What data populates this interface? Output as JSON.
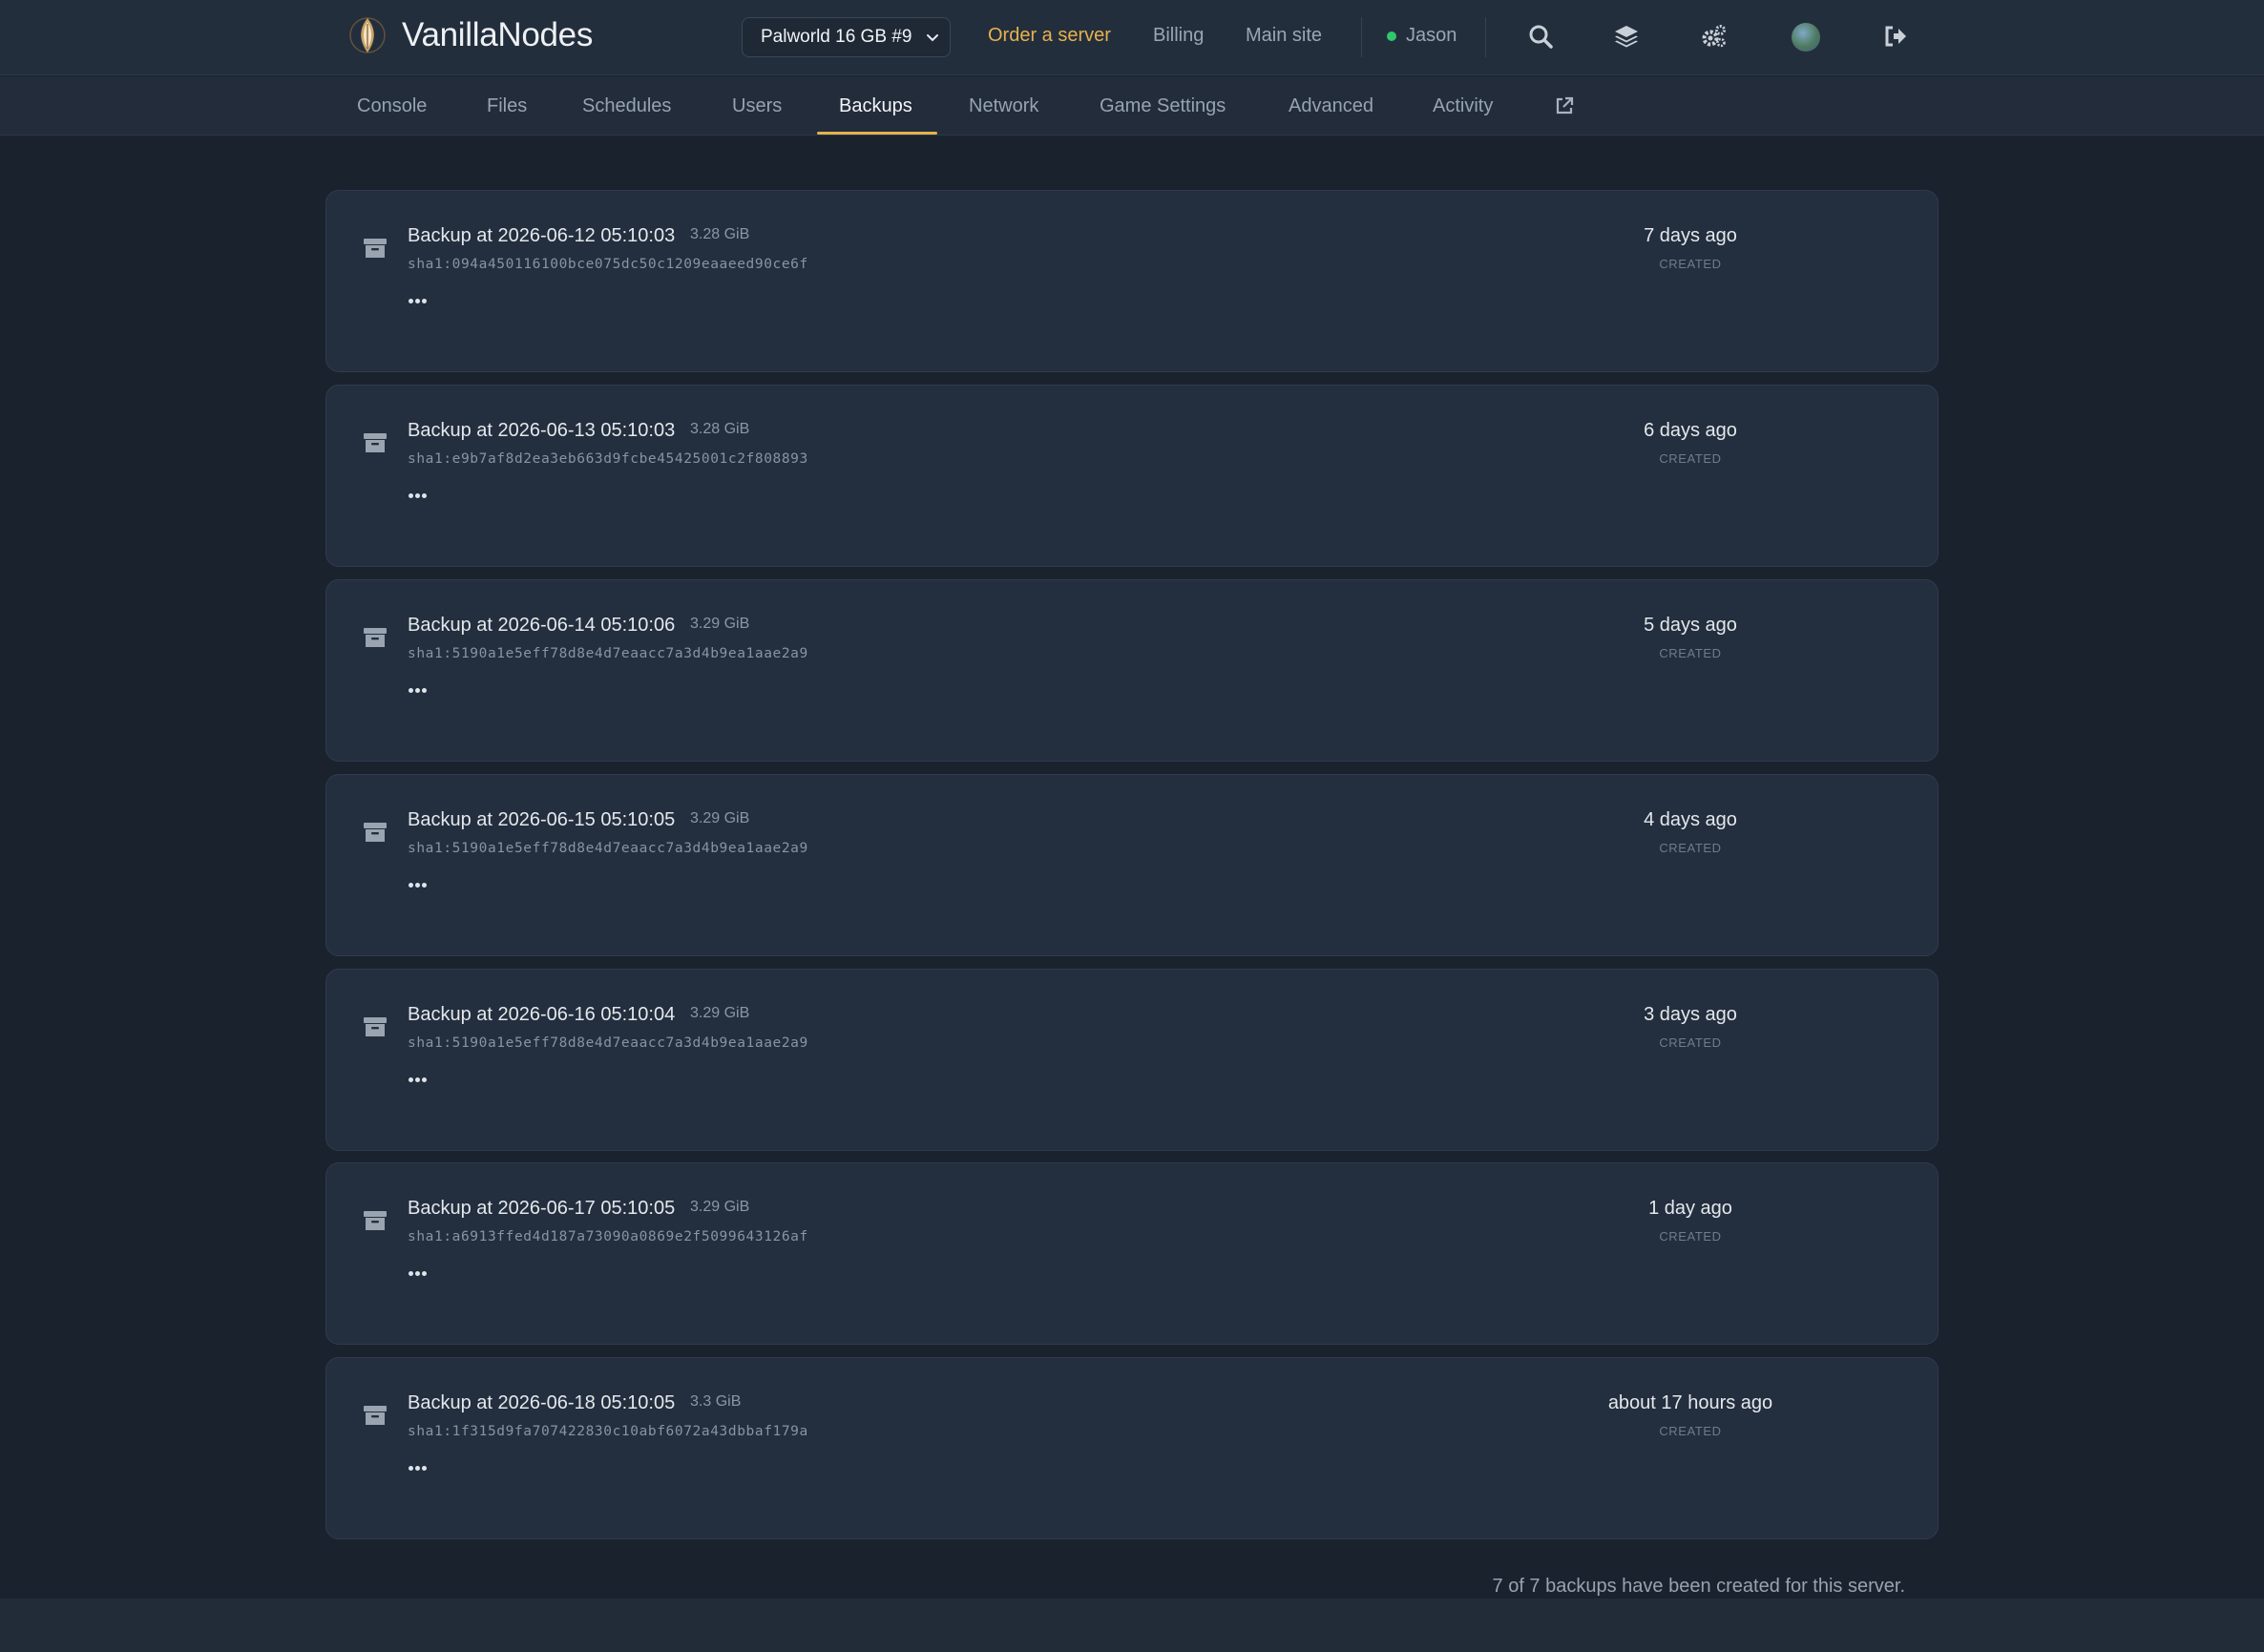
{
  "brand": {
    "name": "VanillaNodes"
  },
  "server_select": {
    "label": "Palworld 16 GB #9"
  },
  "top_nav": {
    "order": "Order a server",
    "billing": "Billing",
    "main_site": "Main site",
    "user": "Jason"
  },
  "tabs": [
    "Console",
    "Files",
    "Schedules",
    "Users",
    "Backups",
    "Network",
    "Game Settings",
    "Advanced",
    "Activity"
  ],
  "active_tab": "Backups",
  "backups": [
    {
      "title": "Backup at 2026-06-12 05:10:03",
      "size": "3.28 GiB",
      "hash": "sha1:094a450116100bce075dc50c1209eaaeed90ce6f",
      "age": "7 days ago",
      "created": "CREATED"
    },
    {
      "title": "Backup at 2026-06-13 05:10:03",
      "size": "3.28 GiB",
      "hash": "sha1:e9b7af8d2ea3eb663d9fcbe45425001c2f808893",
      "age": "6 days ago",
      "created": "CREATED"
    },
    {
      "title": "Backup at 2026-06-14 05:10:06",
      "size": "3.29 GiB",
      "hash": "sha1:5190a1e5eff78d8e4d7eaacc7a3d4b9ea1aae2a9",
      "age": "5 days ago",
      "created": "CREATED"
    },
    {
      "title": "Backup at 2026-06-15 05:10:05",
      "size": "3.29 GiB",
      "hash": "sha1:5190a1e5eff78d8e4d7eaacc7a3d4b9ea1aae2a9",
      "age": "4 days ago",
      "created": "CREATED"
    },
    {
      "title": "Backup at 2026-06-16 05:10:04",
      "size": "3.29 GiB",
      "hash": "sha1:5190a1e5eff78d8e4d7eaacc7a3d4b9ea1aae2a9",
      "age": "3 days ago",
      "created": "CREATED"
    },
    {
      "title": "Backup at 2026-06-17 05:10:05",
      "size": "3.29 GiB",
      "hash": "sha1:a6913ffed4d187a73090a0869e2f5099643126af",
      "age": "1 day ago",
      "created": "CREATED"
    },
    {
      "title": "Backup at 2026-06-18 05:10:05",
      "size": "3.3 GiB",
      "hash": "sha1:1f315d9fa707422830c10abf6072a43dbbaf179a",
      "age": "about 17 hours ago",
      "created": "CREATED"
    }
  ],
  "footer": {
    "text": "7 of 7 backups have been created for this server."
  },
  "colors": {
    "accent": "#e6b24b",
    "status_online": "#2fc96b",
    "background": "#1a222d",
    "card": "#232e3e"
  },
  "icons": [
    "vanilla-bean-logo",
    "chevron-down-icon",
    "status-dot",
    "search-icon",
    "layers-icon",
    "cogs-icon",
    "avatar",
    "sign-out-icon",
    "external-link-icon",
    "archive-icon",
    "more-icon"
  ]
}
